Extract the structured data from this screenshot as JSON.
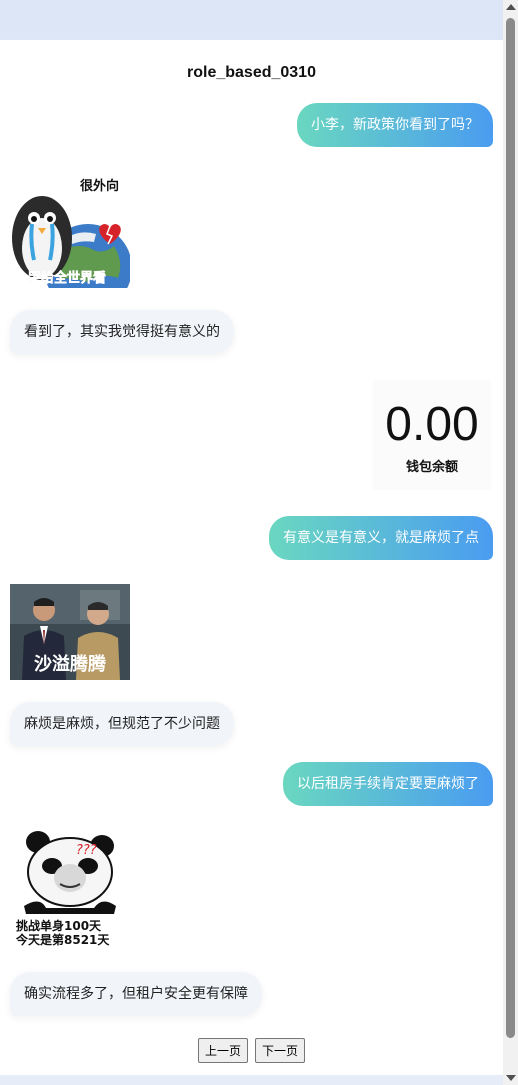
{
  "chat": {
    "title": "role_based_0310",
    "messages": [
      {
        "side": "right",
        "text": "小李，新政策你看到了吗？"
      },
      {
        "side": "left",
        "sticker": {
          "caption_top": "很外向",
          "caption_bottom": "哭给全世界看"
        }
      },
      {
        "side": "left",
        "text": "看到了，其实我觉得挺有意义的"
      },
      {
        "side": "right",
        "wallet": {
          "amount": "0.00",
          "label": "钱包余额"
        }
      },
      {
        "side": "right",
        "text": "有意义是有意义，就是麻烦了点"
      },
      {
        "side": "left",
        "sticker": {
          "caption": "沙溢腾腾"
        }
      },
      {
        "side": "left",
        "text": "麻烦是麻烦，但规范了不少问题"
      },
      {
        "side": "right",
        "text": "以后租房手续肯定要更麻烦了"
      },
      {
        "side": "left",
        "sticker": {
          "mark": "???",
          "line1": "挑战单身100天",
          "line2": "今天是第8521天"
        }
      },
      {
        "side": "left",
        "text": "确实流程多了，但租户安全更有保障"
      }
    ]
  },
  "pager": {
    "prev_label": "上一页",
    "next_label": "下一页"
  },
  "colors": {
    "bubble_gradient_start": "#6ad7c0",
    "bubble_gradient_end": "#4a9cf0",
    "left_bubble": "#f1f4f9"
  }
}
